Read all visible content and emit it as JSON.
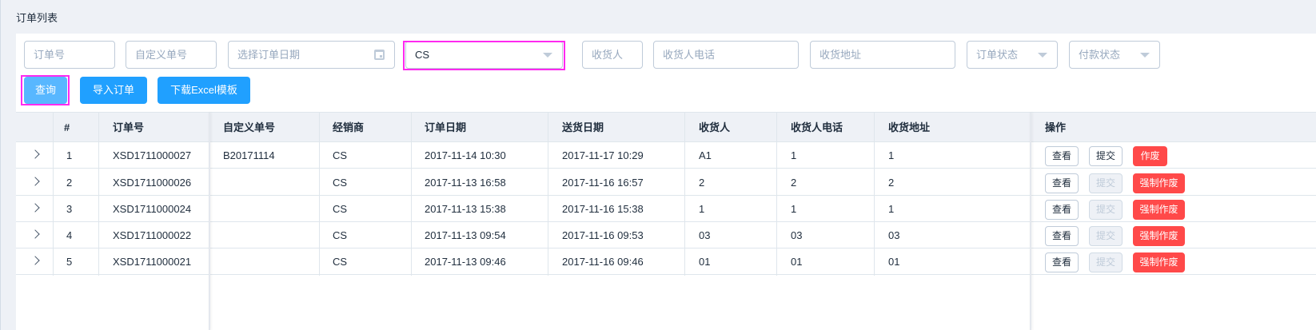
{
  "page": {
    "title": "订单列表"
  },
  "filters": {
    "order_no": "订单号",
    "custom_no": "自定义单号",
    "order_date": "选择订单日期",
    "dealer": "CS",
    "receiver": "收货人",
    "receiver_phone": "收货人电话",
    "address": "收货地址",
    "order_status": "订单状态",
    "payment_status": "付款状态"
  },
  "toolbar": {
    "query": "查询",
    "import": "导入订单",
    "download": "下载Excel模板"
  },
  "table": {
    "headers": {
      "index": "#",
      "order_no": "订单号",
      "custom_no": "自定义单号",
      "dealer": "经销商",
      "order_date": "订单日期",
      "delivery_date": "送货日期",
      "receiver": "收货人",
      "phone": "收货人电话",
      "address": "收货地址",
      "actions": "操作"
    },
    "rows": [
      {
        "index": "1",
        "order_no": "XSD1711000027",
        "custom_no": "B20171114",
        "dealer": "CS",
        "order_date": "2017-11-14 10:30",
        "delivery_date": "2017-11-17 10:29",
        "receiver": "A1",
        "phone": "1",
        "address": "1",
        "view": "查看",
        "submit": "提交",
        "void": "作废"
      },
      {
        "index": "2",
        "order_no": "XSD1711000026",
        "custom_no": "",
        "dealer": "CS",
        "order_date": "2017-11-13 16:58",
        "delivery_date": "2017-11-16 16:57",
        "receiver": "2",
        "phone": "2",
        "address": "2",
        "view": "查看",
        "submit": "提交",
        "void": "强制作废"
      },
      {
        "index": "3",
        "order_no": "XSD1711000024",
        "custom_no": "",
        "dealer": "CS",
        "order_date": "2017-11-13 15:38",
        "delivery_date": "2017-11-16 15:38",
        "receiver": "1",
        "phone": "1",
        "address": "1",
        "view": "查看",
        "submit": "提交",
        "void": "强制作废"
      },
      {
        "index": "4",
        "order_no": "XSD1711000022",
        "custom_no": "",
        "dealer": "CS",
        "order_date": "2017-11-13 09:54",
        "delivery_date": "2017-11-16 09:53",
        "receiver": "03",
        "phone": "03",
        "address": "03",
        "view": "查看",
        "submit": "提交",
        "void": "强制作废"
      },
      {
        "index": "5",
        "order_no": "XSD1711000021",
        "custom_no": "",
        "dealer": "CS",
        "order_date": "2017-11-13 09:46",
        "delivery_date": "2017-11-16 09:46",
        "receiver": "01",
        "phone": "01",
        "address": "01",
        "view": "查看",
        "submit": "提交",
        "void": "强制作废"
      }
    ]
  },
  "colors": {
    "primary": "#20a0ff",
    "primary_light": "#58b7ff",
    "danger": "#ff4949",
    "highlight": "#ff29f0",
    "border": "#bfcbd9",
    "header_bg": "#eef1f6"
  }
}
